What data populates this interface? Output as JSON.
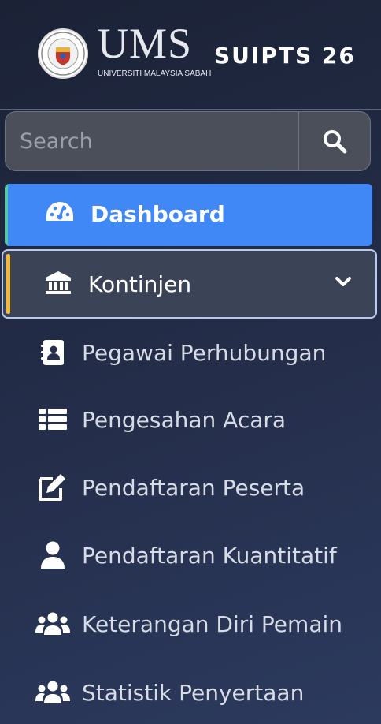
{
  "header": {
    "logo_text": "UMS",
    "logo_subtitle": "UNIVERSITI MALAYSIA SABAH",
    "brand": "SUIPTS 26"
  },
  "search": {
    "placeholder": "Search",
    "button_icon": "search-icon"
  },
  "nav": {
    "dashboard": {
      "label": "Dashboard",
      "icon": "tachometer-icon"
    },
    "kontinjen": {
      "label": "Kontinjen",
      "icon": "institution-icon",
      "expanded": true
    },
    "items": [
      {
        "label": "Pegawai Perhubungan",
        "icon": "address-book-icon"
      },
      {
        "label": "Pengesahan Acara",
        "icon": "list-icon"
      },
      {
        "label": "Pendaftaran Peserta",
        "icon": "edit-icon"
      },
      {
        "label": "Pendaftaran Kuantitatif",
        "icon": "user-icon"
      },
      {
        "label": "Keterangan Diri Pemain",
        "icon": "users-icon"
      },
      {
        "label": "Statistik Penyertaan",
        "icon": "users-icon"
      }
    ]
  },
  "colors": {
    "active": "#3f88f6",
    "active_accent": "#55c6a6",
    "expanded_accent": "#f1b83a",
    "sidebar_bg": "#232c47"
  }
}
